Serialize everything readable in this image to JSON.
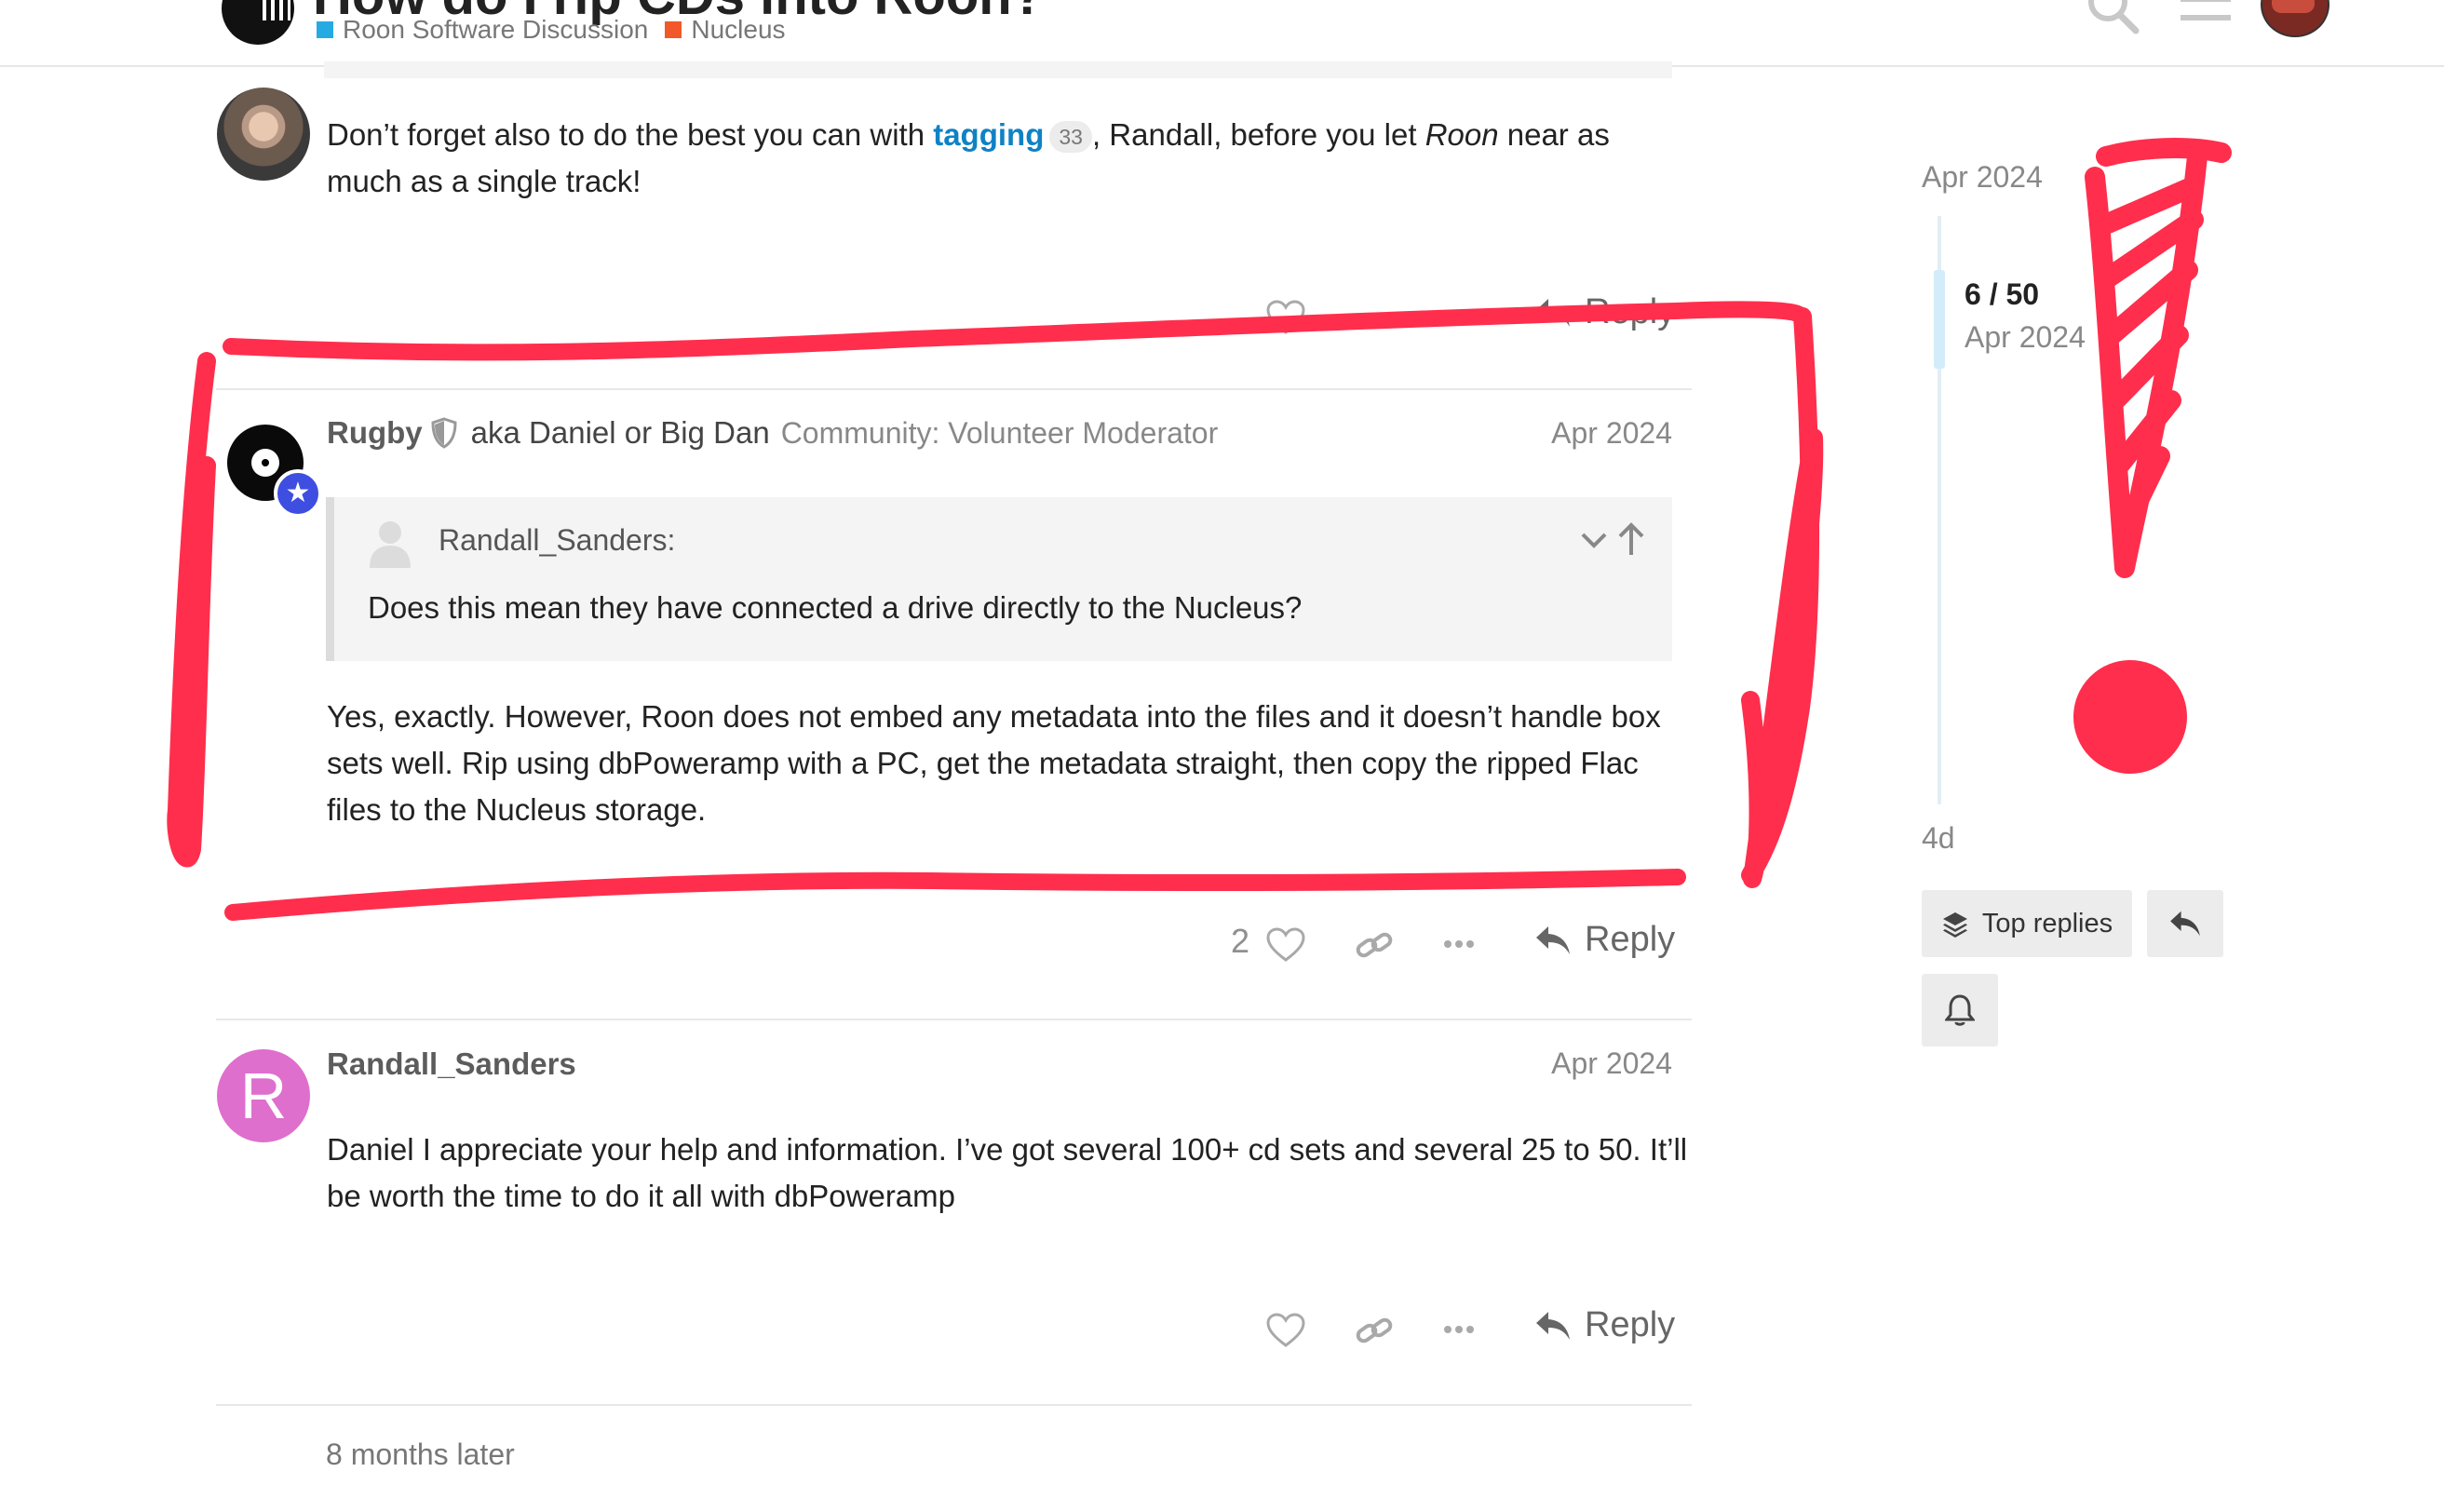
{
  "header": {
    "topic_title": "How do I rip CDs into Roon?",
    "categories": [
      {
        "label": "Roon Software Discussion",
        "color": "#25AAE2"
      },
      {
        "label": "Nucleus",
        "color": "#F1592A"
      }
    ],
    "icons": [
      "search-icon",
      "hamburger-menu-icon",
      "user-avatar"
    ]
  },
  "posts": [
    {
      "text_before_link": "Don’t forget also to do the best you can with ",
      "link_text": "tagging",
      "link_count": "33",
      "text_middle": ", Randall, before you let ",
      "text_italic": "Roon",
      "text_after": " near as much as a single track!",
      "reply_label": "Reply"
    },
    {
      "username": "Rugby",
      "full_name": "aka Daniel or Big Dan",
      "user_title": "Community: Volunteer Moderator",
      "date": "Apr 2024",
      "quote": {
        "username": "Randall_Sanders:",
        "text": "Does this mean they have connected a drive directly to the Nucleus?"
      },
      "body": "Yes, exactly. However, Roon does not embed any metadata into the files and it doesn’t handle box sets well. Rip using dbPoweramp with a PC, get the metadata straight, then copy the ripped Flac files to the Nucleus storage.",
      "likes": "2",
      "reply_label": "Reply"
    },
    {
      "username": "Randall_Sanders",
      "avatar_letter": "R",
      "date": "Apr 2024",
      "body": "Daniel I appreciate your help and information. I’ve got several 100+ cd sets and several 25 to 50. It’ll be worth the time to do it all with dbPoweramp",
      "reply_label": "Reply"
    }
  ],
  "time_gap": "8 months later",
  "timeline": {
    "start_date": "Apr 2024",
    "position": "6 / 50",
    "position_date": "Apr 2024",
    "end_date": "4d",
    "top_replies_label": "Top replies"
  },
  "annotation_color": "#FF2E4D"
}
